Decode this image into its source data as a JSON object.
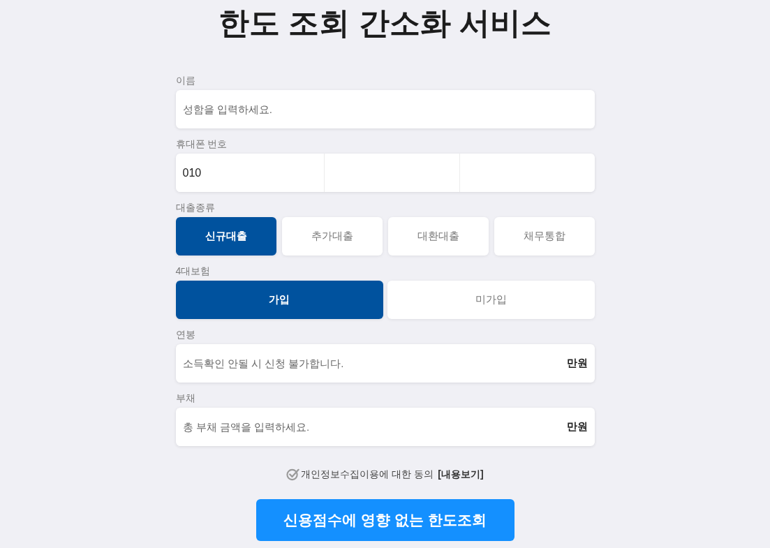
{
  "title": "한도 조회 간소화 서비스",
  "name": {
    "label": "이름",
    "placeholder": "성함을 입력하세요."
  },
  "phone": {
    "label": "휴대폰 번호",
    "segments": [
      {
        "kind": "filled",
        "value": "010"
      },
      {
        "kind": "empty"
      },
      {
        "kind": "empty"
      }
    ]
  },
  "loan_type": {
    "label": "대출종류",
    "options": [
      {
        "label": "신규대출",
        "selected": true
      },
      {
        "label": "추가대출",
        "selected": false
      },
      {
        "label": "대환대출",
        "selected": false
      },
      {
        "label": "채무통합",
        "selected": false
      }
    ]
  },
  "insurance": {
    "label": "4대보험",
    "options": [
      {
        "label": "가입",
        "selected": true
      },
      {
        "label": "미가입",
        "selected": false
      }
    ]
  },
  "salary": {
    "label": "연봉",
    "placeholder": "소득확인 안될 시 신청 불가합니다.",
    "unit": "만원"
  },
  "debt": {
    "label": "부채",
    "placeholder": "총 부채 금액을 입력하세요.",
    "unit": "만원"
  },
  "consent": {
    "checked": false,
    "text": "개인정보수집이용에 대한 동의",
    "link": "[내용보기]"
  },
  "submit": {
    "label": "신용점수에 영향 없는 한도조회"
  }
}
